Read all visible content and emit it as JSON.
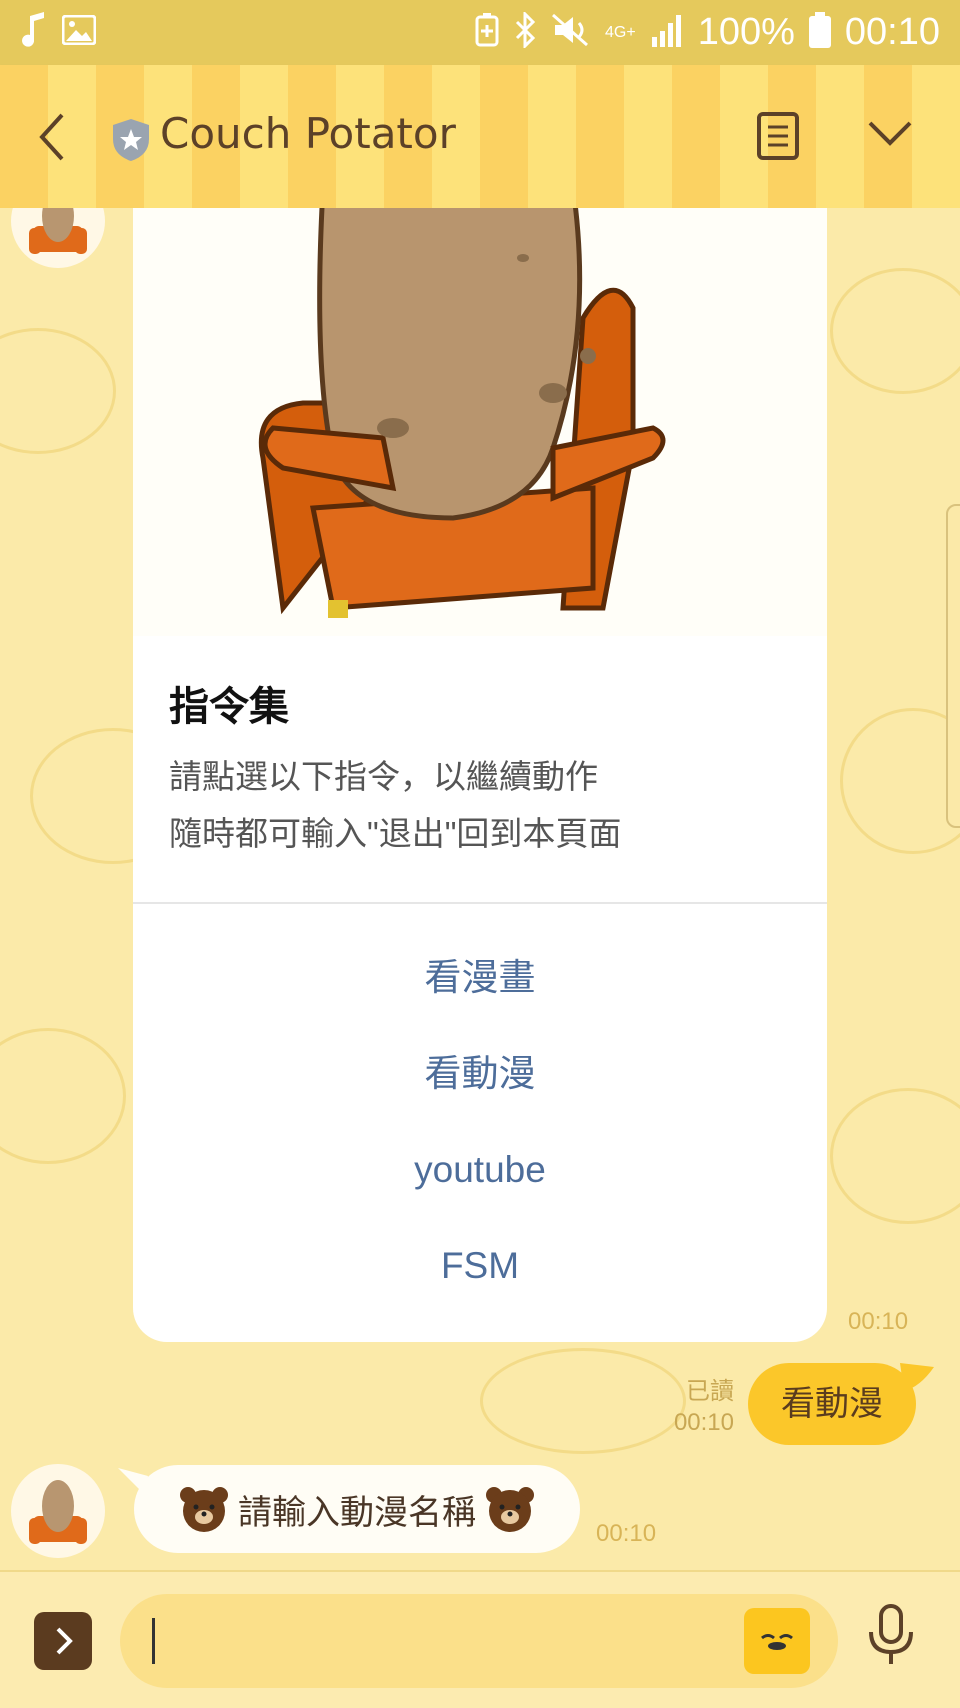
{
  "status_bar": {
    "battery": "100%",
    "time": "00:10",
    "network": "4G+"
  },
  "header": {
    "title": "Couch Potator"
  },
  "card": {
    "title": "指令集",
    "description_line1": "請點選以下指令，以繼續動作",
    "description_line2": "隨時都可輸入\"退出\"回到本頁面",
    "actions": [
      "看漫畫",
      "看動漫",
      "youtube",
      "FSM"
    ],
    "time": "00:10"
  },
  "my_message": {
    "text": "看動漫",
    "read_label": "已讀",
    "time": "00:10"
  },
  "bot_message": {
    "text": "請輸入動漫名稱",
    "time": "00:10"
  },
  "colors": {
    "header_stripe_a": "#fbd262",
    "header_stripe_b": "#fde27a",
    "chat_bg": "#fbeaa9",
    "my_bubble": "#fbc72a",
    "action_link": "#4d6d9a"
  }
}
